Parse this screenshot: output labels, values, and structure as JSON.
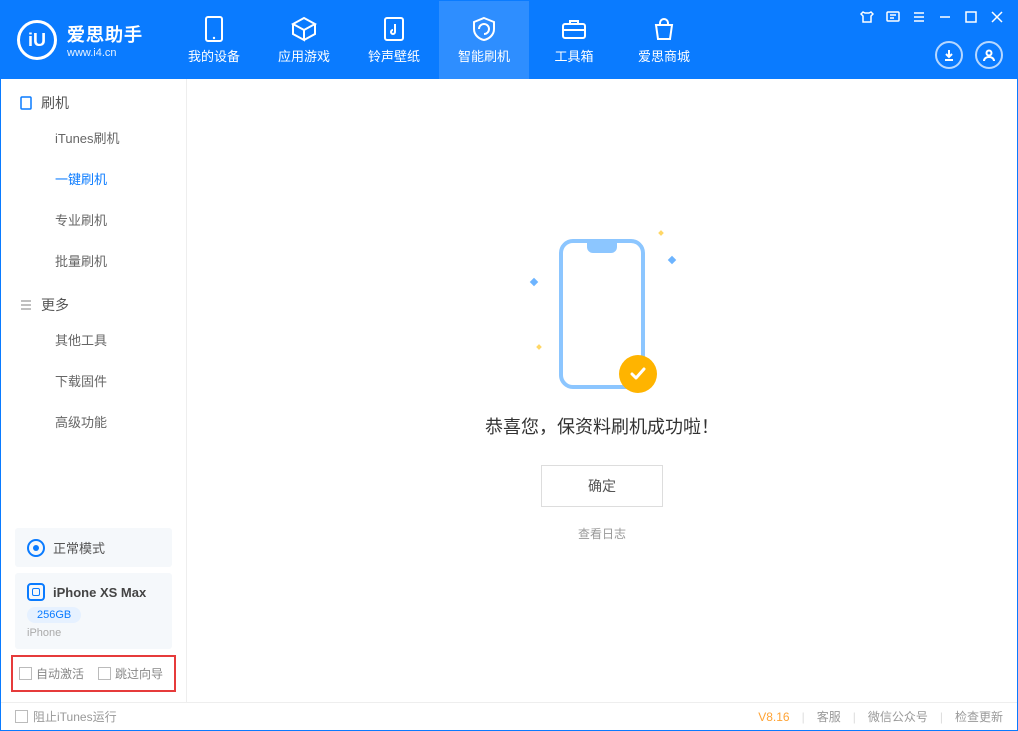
{
  "brand": {
    "name": "爱思助手",
    "url": "www.i4.cn",
    "logo_letter": "iU"
  },
  "nav": [
    {
      "label": "我的设备"
    },
    {
      "label": "应用游戏"
    },
    {
      "label": "铃声壁纸"
    },
    {
      "label": "智能刷机"
    },
    {
      "label": "工具箱"
    },
    {
      "label": "爱思商城"
    }
  ],
  "sidebar": {
    "section1_title": "刷机",
    "items1": [
      {
        "label": "iTunes刷机"
      },
      {
        "label": "一键刷机"
      },
      {
        "label": "专业刷机"
      },
      {
        "label": "批量刷机"
      }
    ],
    "section2_title": "更多",
    "items2": [
      {
        "label": "其他工具"
      },
      {
        "label": "下载固件"
      },
      {
        "label": "高级功能"
      }
    ],
    "mode_label": "正常模式",
    "device": {
      "name": "iPhone XS Max",
      "capacity": "256GB",
      "type": "iPhone"
    },
    "auto_activate_label": "自动激活",
    "skip_guide_label": "跳过向导"
  },
  "main": {
    "success_text": "恭喜您，保资料刷机成功啦！",
    "ok_button": "确定",
    "view_log": "查看日志"
  },
  "footer": {
    "block_itunes": "阻止iTunes运行",
    "version": "V8.16",
    "customer_service": "客服",
    "wechat": "微信公众号",
    "check_update": "检查更新"
  }
}
